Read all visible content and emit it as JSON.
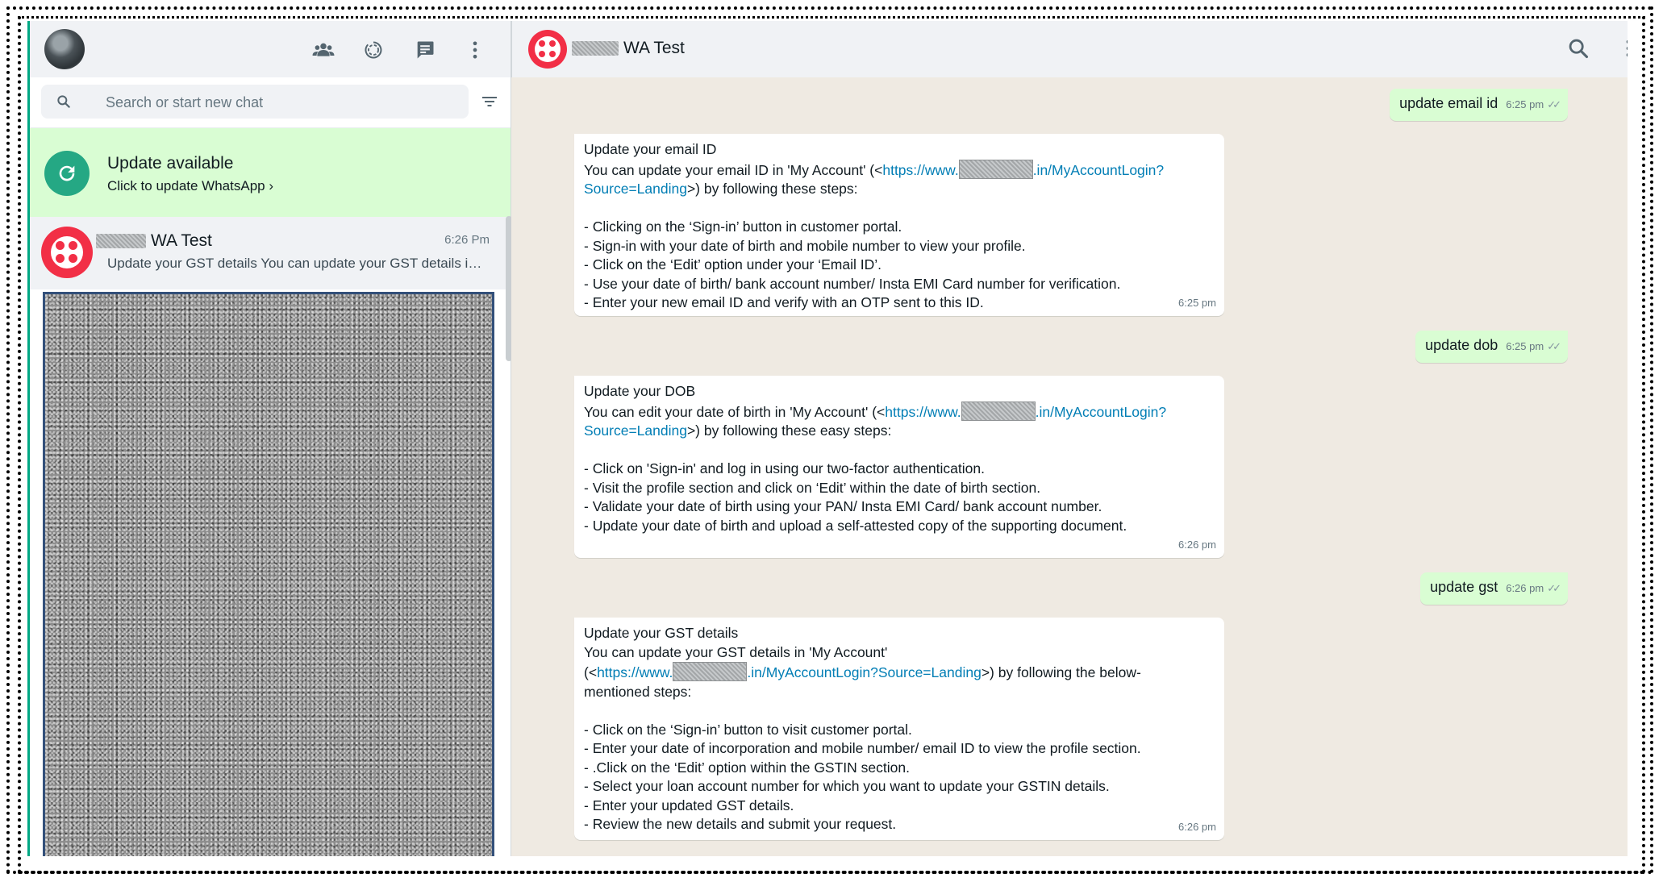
{
  "sidebar": {
    "search": {
      "placeholder": "Search or start new chat",
      "value": ""
    },
    "update_banner": {
      "title": "Update available",
      "subtitle": "Click to update WhatsApp ›"
    },
    "chat": {
      "name": "WA Test",
      "time": "6:26 Pm",
      "preview": "Update your GST details You can update your GST details in 'My Account'"
    },
    "icons": [
      "community-icon",
      "status-icon",
      "new-chat-icon",
      "menu-icon",
      "search-icon",
      "filter-icon",
      "refresh-icon"
    ]
  },
  "conversation": {
    "title": "WA Test",
    "messages": [
      {
        "direction": "out",
        "text": "update email id",
        "time": "6:25 pm"
      },
      {
        "direction": "in",
        "time": "6:25 pm",
        "title": "Update your email ID",
        "intro_before": "You can update your email ID in 'My Account' (<",
        "link_a": "https://www.",
        "link_b": ".in/MyAccountLogin?",
        "link_c": "Source=Landing",
        "intro_after": ">) by following these steps:",
        "steps": [
          "- Clicking on the ‘Sign-in’ button in customer portal.",
          "- Sign-in with your date of birth and mobile number to view your profile.",
          "- Click on the ‘Edit’ option under your ‘Email ID’.",
          "- Use your date of birth/ bank account number/ Insta EMI Card number for verification.",
          "- Enter your new email ID and verify with an OTP sent to this ID."
        ]
      },
      {
        "direction": "out",
        "text": "update dob",
        "time": "6:25 pm"
      },
      {
        "direction": "in",
        "time": "6:26 pm",
        "title": "Update your DOB",
        "intro_before": "You can edit your date of birth in 'My Account' (<",
        "link_a": "https://www.",
        "link_b": ".in/MyAccountLogin?",
        "link_c": "Source=Landing",
        "intro_after": ">) by following these easy steps:",
        "steps": [
          "- Click on 'Sign-in' and log in using our two-factor authentication.",
          "- Visit the profile section and click on ‘Edit’ within the date of birth section.",
          "- Validate your date of birth using your PAN/ Insta EMI Card/ bank account number.",
          "- Update your date of birth and upload a self-attested copy of the supporting document."
        ]
      },
      {
        "direction": "out",
        "text": "update gst",
        "time": "6:26 pm"
      },
      {
        "direction": "in",
        "time": "6:26 pm",
        "title": "Update your GST details",
        "intro_line1": "You can update your GST details in 'My Account'",
        "intro_before": "(<",
        "link_a": "https://www.",
        "link_b": ".in/MyAccountLogin?Source=Landing",
        "intro_after": ">) by following the below-",
        "intro_line3": "mentioned steps:",
        "steps": [
          "- Click on the ‘Sign-in’ button to visit customer portal.",
          "- Enter your date of incorporation and mobile number/ email ID to view the profile section.",
          "- .Click on the ‘Edit’ option within the GSTIN section.",
          "- Select your loan account number for which you want to update your GSTIN details.",
          "- Enter your updated GST details.",
          "- Review the new details and submit your request."
        ]
      }
    ]
  },
  "colors": {
    "accent": "#00a884",
    "outgoing": "#d9fdd3",
    "link": "#027eb5",
    "twilio": "#f22f46"
  }
}
